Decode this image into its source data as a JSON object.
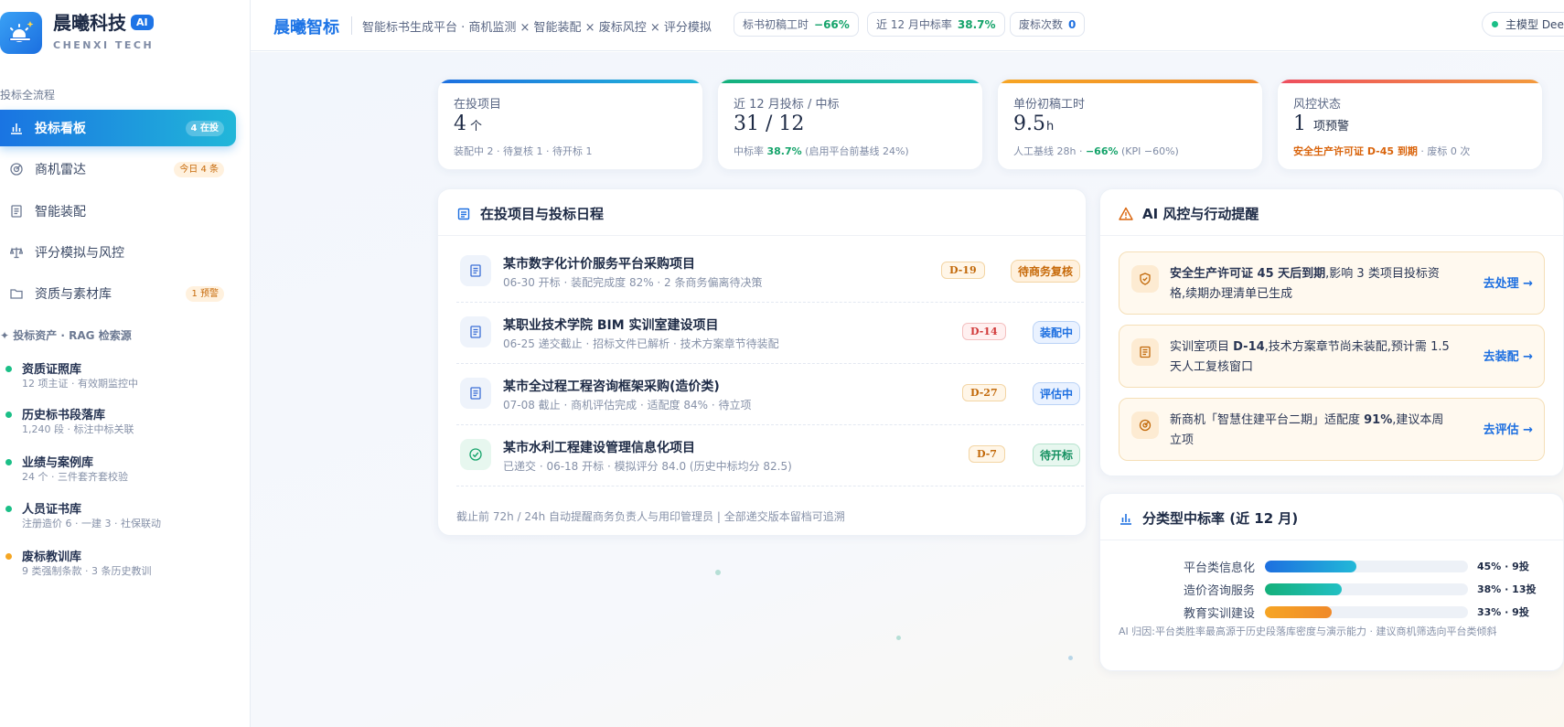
{
  "sidebar": {
    "brand_name": "晨曦科技",
    "brand_badge": "AI",
    "brand_en": "CHENXI TECH",
    "section_title": "投标全流程",
    "nav": [
      {
        "label": "投标看板",
        "tag": "4 在投",
        "icon": "chart-bar-icon"
      },
      {
        "label": "商机雷达",
        "tag": "今日 4 条",
        "icon": "radar-icon"
      },
      {
        "label": "智能装配",
        "icon": "document-icon"
      },
      {
        "label": "评分模拟与风控",
        "icon": "scale-icon"
      },
      {
        "label": "资质与素材库",
        "tag": "1 预警",
        "icon": "folder-icon"
      }
    ],
    "rag_title": "✦ 投标资产 · RAG 检索源",
    "assets": [
      {
        "name": "资质证照库",
        "desc": "12 项主证 · 有效期监控中",
        "color": "#1bbf87"
      },
      {
        "name": "历史标书段落库",
        "desc": "1,240 段 · 标注中标关联",
        "color": "#1bbf87"
      },
      {
        "name": "业绩与案例库",
        "desc": "24 个 · 三件套齐套校验",
        "color": "#1bbf87"
      },
      {
        "name": "人员证书库",
        "desc": "注册造价 6 · 一建 3 · 社保联动",
        "color": "#1bbf87"
      },
      {
        "name": "废标教训库",
        "desc": "9 类强制条款 · 3 条历史教训",
        "color": "#f5a623"
      }
    ]
  },
  "topbar": {
    "title": "晨曦智标",
    "subtitle": "智能标书生成平台 · 商机监测 × 智能装配 × 废标风控 × 评分模拟",
    "pills": [
      {
        "label": "标书初稿工时",
        "value": "−66%",
        "color": "#14a36a"
      },
      {
        "label": "近 12 月中标率",
        "value": "38.7%",
        "color": "#14a36a"
      },
      {
        "label": "废标次数",
        "value": "0",
        "color": "#1d6fe0"
      }
    ],
    "model": "主模型 Dee"
  },
  "stats": [
    {
      "label": "在投项目",
      "value": "4",
      "unit": "个",
      "note": "装配中 2 · 待复核 1 · 待开标 1",
      "bar": "linear-gradient(90deg,#1d6fe0,#22b8d8)"
    },
    {
      "label": "近 12 月投标 / 中标",
      "value": "31 / 12",
      "unit": "",
      "note_pre": "中标率 ",
      "note_hl": "38.7%",
      "note_post": " (启用平台前基线 24%)",
      "hl_color": "#14a36a",
      "bar": "linear-gradient(90deg,#14b07a,#22c0c4)"
    },
    {
      "label": "单份初稿工时",
      "value": "9.5",
      "unit": "h",
      "note_pre": "人工基线 28h · ",
      "note_hl": "−66%",
      "note_post": " (KPI −60%)",
      "hl_color": "#14a36a",
      "bar": "linear-gradient(90deg,#f6a524,#f08a2a)"
    },
    {
      "label": "风控状态",
      "value": "1",
      "unit": "项预警",
      "note_pre": "",
      "note_hl": "安全生产许可证 D-45 到期",
      "note_post": " · 废标 0 次",
      "hl_color": "#d9640c",
      "bar": "linear-gradient(90deg,#ee4d5f,#f39b3c)"
    }
  ],
  "projects_panel": {
    "title": "在投项目与投标日程",
    "items": [
      {
        "name": "某市数字化计价服务平台采购项目",
        "desc": "06-30 开标 · 装配完成度 82% · 2 条商务偏离待决策",
        "d": "D-19",
        "d_bg": "#fff6e8",
        "d_fg": "#c2690a",
        "d_bd": "#f3d5a4",
        "status": "待商务复核",
        "s_bg": "#fff1de",
        "s_fg": "#c76a0a",
        "s_bd": "#f3d5a4",
        "icon": "document-icon",
        "icon_bg": "#eef3fb"
      },
      {
        "name": "某职业技术学院 BIM 实训室建设项目",
        "desc": "06-25 递交截止 · 招标文件已解析 · 技术方案章节待装配",
        "d": "D-14",
        "d_bg": "#fff0f0",
        "d_fg": "#d13a3a",
        "d_bd": "#f4c0c0",
        "status": "装配中",
        "s_bg": "#eaf2ff",
        "s_fg": "#1d6fe0",
        "s_bd": "#b9d2f6",
        "icon": "document-icon",
        "icon_bg": "#eef3fb"
      },
      {
        "name": "某市全过程工程咨询框架采购(造价类)",
        "desc": "07-08 截止 · 商机评估完成 · 适配度 84% · 待立项",
        "d": "D-27",
        "d_bg": "#fff6e8",
        "d_fg": "#c2690a",
        "d_bd": "#f3d5a4",
        "status": "评估中",
        "s_bg": "#eaf2ff",
        "s_fg": "#1d6fe0",
        "s_bd": "#b9d2f6",
        "icon": "document-icon",
        "icon_bg": "#eef3fb"
      },
      {
        "name": "某市水利工程建设管理信息化项目",
        "desc": "已递交 · 06-18 开标 · 模拟评分 84.0 (历史中标均分 82.5)",
        "d": "D-7",
        "d_bg": "#fff6e8",
        "d_fg": "#c2690a",
        "d_bd": "#f3d5a4",
        "status": "待开标",
        "s_bg": "#e7f7ef",
        "s_fg": "#149060",
        "s_bd": "#b5e3cd",
        "icon": "check-icon",
        "icon_bg": "#e7f7ef"
      }
    ],
    "footer": "截止前 72h / 24h 自动提醒商务负责人与用印管理员  |  全部递交版本留档可追溯"
  },
  "risk_panel": {
    "title": "AI 风控与行动提醒",
    "items": [
      {
        "pre": "",
        "bold": "安全生产许可证 45 天后到期",
        "post": ",影响 3 类项目投标资格,续期办理清单已生成",
        "action": "去处理 →",
        "icon": "shield-icon"
      },
      {
        "pre": "实训室项目 ",
        "bold": "D-14",
        "post": ",技术方案章节尚未装配,预计需 1.5 天人工复核窗口",
        "action": "去装配 →",
        "icon": "document-icon"
      },
      {
        "pre": "新商机「智慧住建平台二期」适配度 ",
        "bold": "91%",
        "post": ",建议本周立项",
        "action": "去评估 →",
        "icon": "radar-icon"
      }
    ]
  },
  "rate_panel": {
    "title": "分类型中标率 (近 12 月)",
    "rows": [
      {
        "label": "平台类信息化",
        "pct": 45,
        "value": "45% · 9投",
        "fill": "linear-gradient(90deg,#1d6fe0,#22b8d8)"
      },
      {
        "label": "造价咨询服务",
        "pct": 38,
        "value": "38% · 13投",
        "fill": "linear-gradient(90deg,#14b07a,#22c0c4)"
      },
      {
        "label": "教育实训建设",
        "pct": 33,
        "value": "33% · 9投",
        "fill": "linear-gradient(90deg,#f6a524,#f08a2a)"
      }
    ],
    "note": "AI 归因:平台类胜率最高源于历史段落库密度与演示能力 · 建议商机筛选向平台类倾斜"
  }
}
